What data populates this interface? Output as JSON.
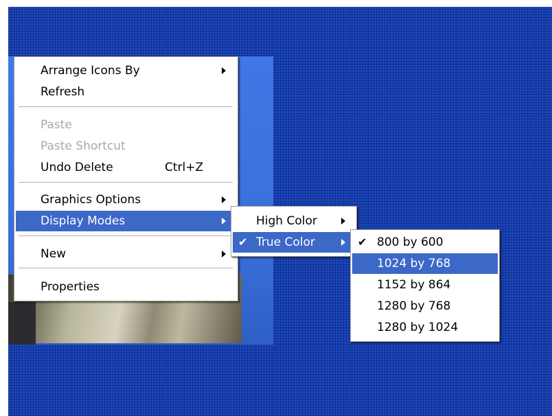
{
  "context_menu": {
    "arrange_icons_by": "Arrange Icons By",
    "refresh": "Refresh",
    "paste": "Paste",
    "paste_shortcut": "Paste Shortcut",
    "undo_delete": "Undo Delete",
    "undo_delete_shortcut": "Ctrl+Z",
    "graphics_options": "Graphics Options",
    "display_modes": "Display Modes",
    "new": "New",
    "properties": "Properties"
  },
  "display_modes_menu": {
    "high_color": "High Color",
    "true_color": "True Color",
    "checked_glyph": "✔"
  },
  "resolution_menu": {
    "checked_glyph": "✔",
    "options": [
      "800 by 600",
      "1024 by 768",
      "1152 by 864",
      "1280 by 768",
      "1280 by 1024"
    ]
  },
  "colors": {
    "desktop": "#1c47b8",
    "selection": "#3c68c8",
    "disabled_text": "#a8a8a8"
  }
}
